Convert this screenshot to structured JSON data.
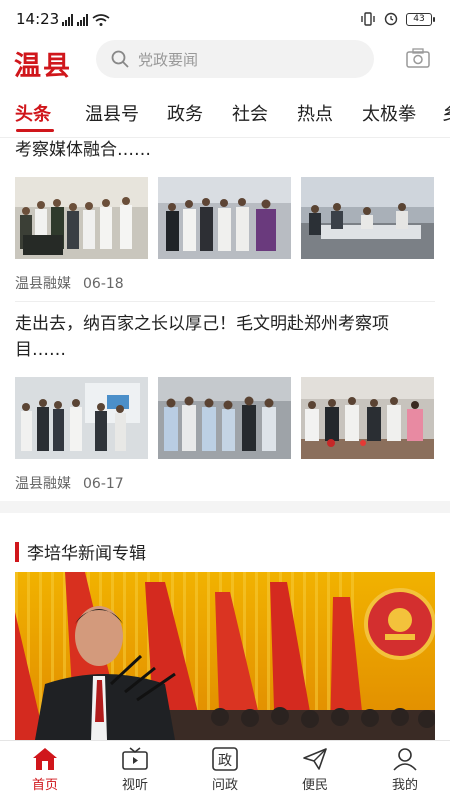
{
  "status_bar": {
    "time": "14:23",
    "battery": "43",
    "network": "4G"
  },
  "header": {
    "logo": "温县",
    "search_placeholder": "党政要闻"
  },
  "tabs": [
    "头条",
    "温县号",
    "政务",
    "社会",
    "热点",
    "太极拳",
    "乡"
  ],
  "active_tab": "头条",
  "articles": [
    {
      "title": "考察媒体融合……",
      "source": "温县融媒",
      "date": "06-18"
    },
    {
      "title": "走出去，纳百家之长以厚己！毛文明赴郑州考察项目……",
      "source": "温县融媒",
      "date": "06-17"
    }
  ],
  "section": {
    "title": "李培华新闻专辑"
  },
  "bottom_nav": [
    {
      "label": "首页",
      "icon": "home-icon",
      "active": true
    },
    {
      "label": "视听",
      "icon": "tv-icon",
      "active": false
    },
    {
      "label": "问政",
      "icon": "zheng-icon",
      "active": false
    },
    {
      "label": "便民",
      "icon": "send-icon",
      "active": false
    },
    {
      "label": "我的",
      "icon": "user-icon",
      "active": false
    }
  ],
  "colors": {
    "accent": "#d0161b",
    "text": "#222222",
    "muted": "#666666"
  }
}
